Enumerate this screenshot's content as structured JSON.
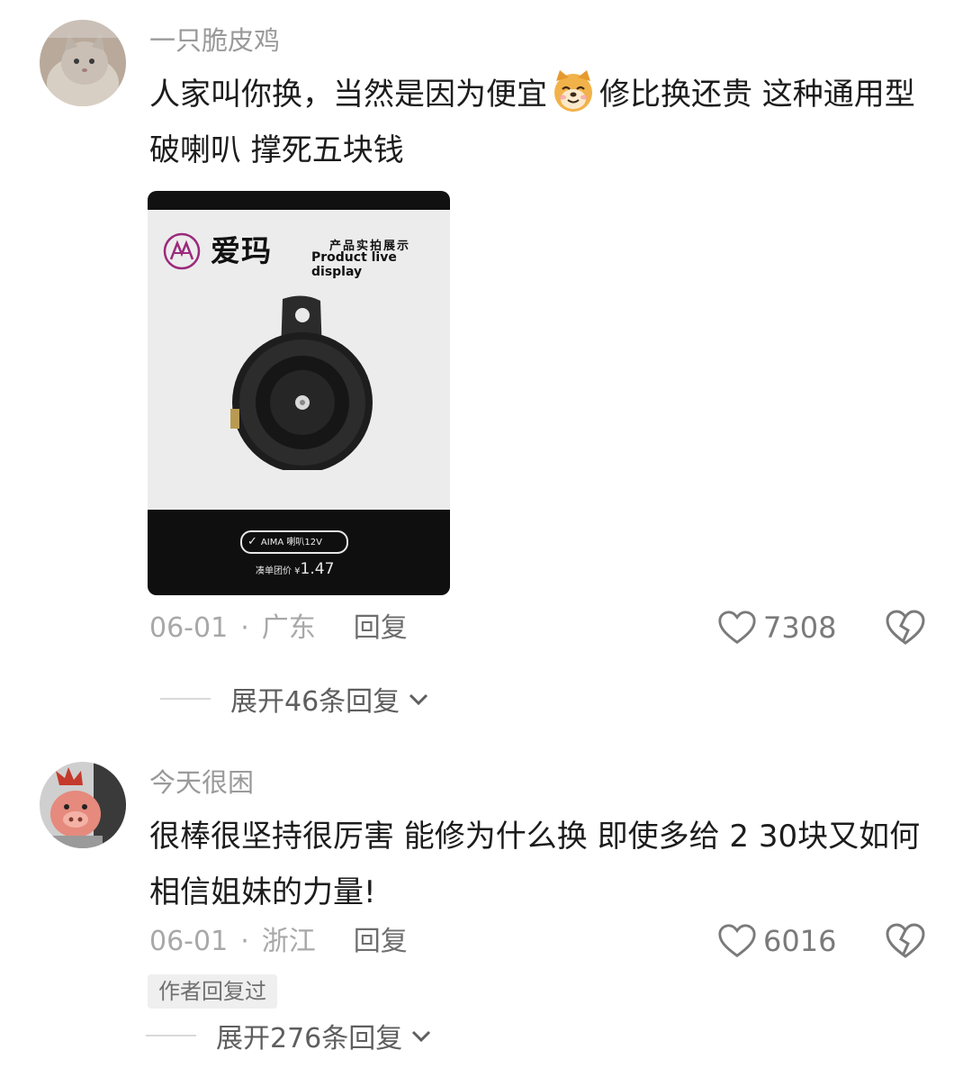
{
  "comments": [
    {
      "username": "一只脆皮鸡",
      "text_part1": "人家叫你换，当然是因为便宜",
      "emoji": "dog-face-emoji",
      "text_part2": "修比换还贵  这种通用型破喇叭  撑死五块钱",
      "image": {
        "brand": "爱玛",
        "subtitle_cn": "产品实拍展示",
        "subtitle_en": "Product live display",
        "tag": "AIMA  喇叭12V",
        "price_label": "凑单团价 ¥",
        "price_value": "1.47"
      },
      "date": "06-01",
      "location": "广东",
      "reply_label": "回复",
      "likes": "7308",
      "expand_label": "展开46条回复"
    },
    {
      "username": "今天很困",
      "text": "很棒很坚持很厉害 能修为什么换 即使多给 2 30块又如何 相信姐妹的力量!",
      "date": "06-01",
      "location": "浙江",
      "reply_label": "回复",
      "likes": "6016",
      "badge": "作者回复过",
      "expand_label": "展开276条回复"
    }
  ],
  "colors": {
    "meta": "#a8a8a8",
    "text": "#1c1c1c",
    "icon": "#7a7a7a"
  }
}
